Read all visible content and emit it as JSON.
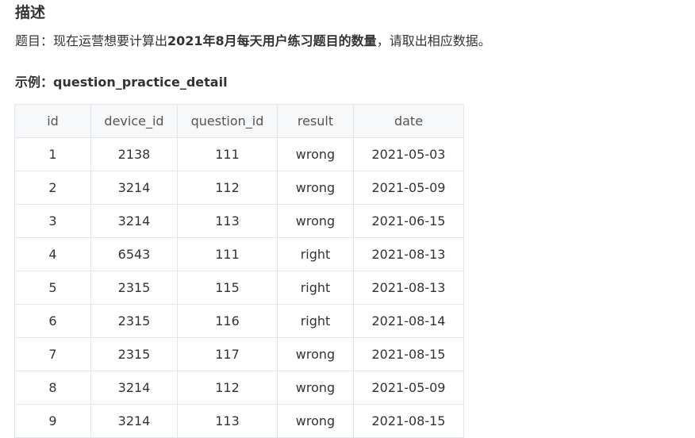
{
  "section_title": "描述",
  "description": {
    "prefix": "题目：现在运营想要计算出",
    "highlight": "2021年8月每天用户练习题目的数量",
    "suffix": "，请取出相应数据。"
  },
  "example_title": "示例：question_practice_detail",
  "table": {
    "headers": [
      "id",
      "device_id",
      "question_id",
      "result",
      "date"
    ],
    "rows": [
      [
        "1",
        "2138",
        "111",
        "wrong",
        "2021-05-03"
      ],
      [
        "2",
        "3214",
        "112",
        "wrong",
        "2021-05-09"
      ],
      [
        "3",
        "3214",
        "113",
        "wrong",
        "2021-06-15"
      ],
      [
        "4",
        "6543",
        "111",
        "right",
        "2021-08-13"
      ],
      [
        "5",
        "2315",
        "115",
        "right",
        "2021-08-13"
      ],
      [
        "6",
        "2315",
        "116",
        "right",
        "2021-08-14"
      ],
      [
        "7",
        "2315",
        "117",
        "wrong",
        "2021-08-15"
      ],
      [
        "8",
        "3214",
        "112",
        "wrong",
        "2021-05-09"
      ],
      [
        "9",
        "3214",
        "113",
        "wrong",
        "2021-08-15"
      ]
    ]
  }
}
